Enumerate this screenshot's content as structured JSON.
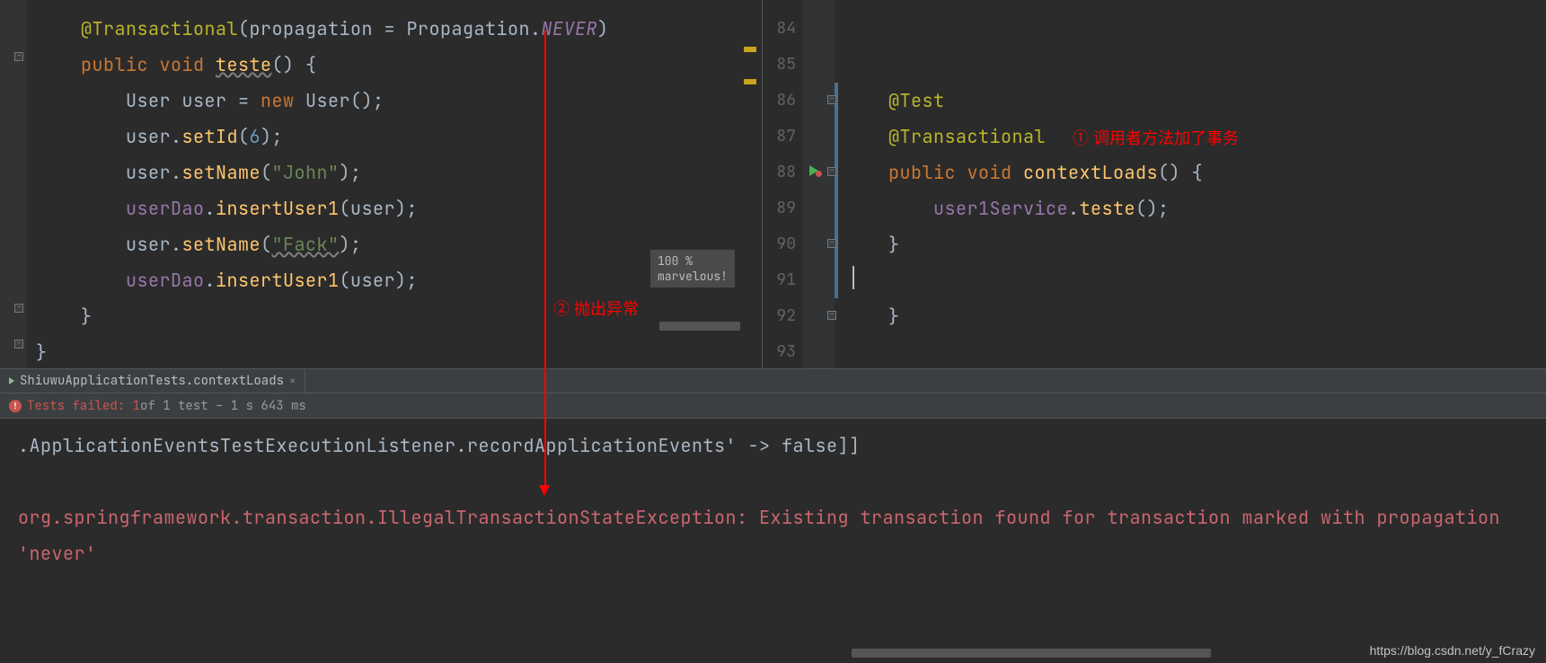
{
  "left_code": {
    "line1_full": "    @Transactional(propagation = Propagation.NEVER)",
    "ann1": "@Transactional",
    "lp": "(",
    "prop_name": "propagation",
    "eq": " = ",
    "prop_class": "Propagation",
    "dot": ".",
    "never": "NEVER",
    "rp": ")",
    "line2_pub": "    public ",
    "void": "void ",
    "teste": "teste",
    "teste_paren": "() {",
    "line3_a": "        User user = ",
    "new": "new ",
    "line3_b": "User();",
    "line4_a": "        user.",
    "setId": "setId",
    "line4_b": "(",
    "six": "6",
    "line4_c": ");",
    "line5_a": "        user.",
    "setName": "setName",
    "line5_b": "(",
    "john": "\"John\"",
    "line5_c": ");",
    "line6_a": "        ",
    "userDao": "userDao",
    "line6_b": ".",
    "insertUser1": "insertUser1",
    "line6_c": "(user);",
    "line7_a": "        user.",
    "line7_b": "(",
    "fack": "\"Fack\"",
    "line7_c": ");",
    "line8_a": "        ",
    "line8_c": "(user);",
    "line9": "    }",
    "line10": "}"
  },
  "right_code": {
    "nums": [
      "84",
      "85",
      "86",
      "87",
      "88",
      "89",
      "90",
      "91",
      "92",
      "93"
    ],
    "l3_ann": "@Test",
    "l4_ann": "@Transactional",
    "l5_pub": "public ",
    "l5_void": "void ",
    "l5_fn": "contextLoads",
    "l5_rest": "() {",
    "l6_a": "    ",
    "l6_field": "user1Service",
    "l6_b": ".",
    "l6_fn": "teste",
    "l6_c": "();",
    "l7": "}",
    "l9": "}"
  },
  "marvelous": {
    "l1": "100 %",
    "l2": "marvelous!"
  },
  "annotations": {
    "a1": "① 调用者方法加了事务",
    "a2": "② 抛出异常"
  },
  "tab": {
    "label": "ShiuwuApplicationTests.contextLoads"
  },
  "status": {
    "prefix": "Tests failed: 1",
    "suffix": " of 1 test – 1 s 643 ms"
  },
  "console": {
    "line1": ".ApplicationEventsTestExecutionListener.recordApplicationEvents' -> false]]",
    "line2": "org.springframework.transaction.IllegalTransactionStateException: Existing transaction found for transaction marked with propagation 'never'"
  },
  "watermark": "https://blog.csdn.net/y_fCrazy"
}
